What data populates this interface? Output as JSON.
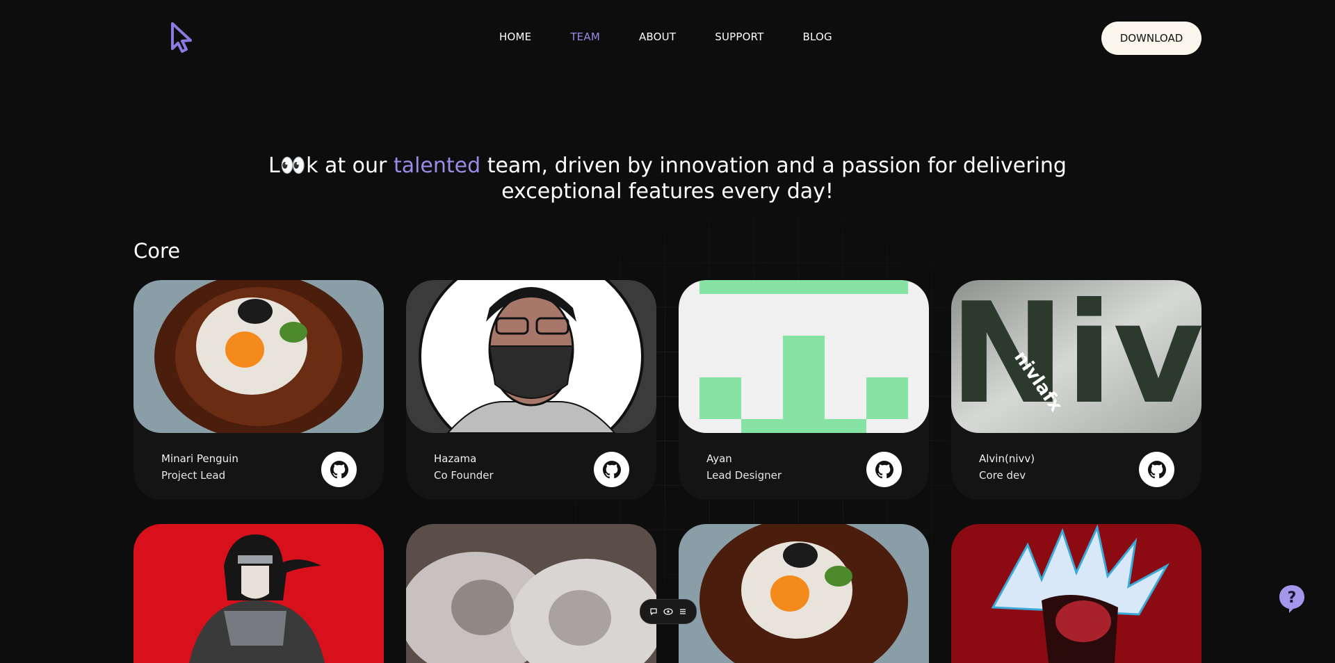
{
  "nav": {
    "items": [
      {
        "label": "HOME"
      },
      {
        "label": "TEAM",
        "active": true
      },
      {
        "label": "ABOUT"
      },
      {
        "label": "SUPPORT"
      },
      {
        "label": "BLOG"
      }
    ],
    "download_label": "DOWNLOAD"
  },
  "hero": {
    "part1": "L",
    "eyes": "👀",
    "part2": "k at our ",
    "accent": "talented",
    "part3": " team, driven by innovation and a passion for delivering",
    "line2": "exceptional features every day!"
  },
  "section": {
    "title": "Core"
  },
  "members": [
    {
      "name": "Minari Penguin",
      "role": "Project Lead"
    },
    {
      "name": "Hazama",
      "role": "Co Founder"
    },
    {
      "name": "Ayan",
      "role": "Lead Designer"
    },
    {
      "name": "Alvin(nivv)",
      "role": "Core dev"
    }
  ],
  "avatar_text": {
    "niv": "Niv",
    "nivlafx": "nivlafx"
  },
  "colors": {
    "accent": "#9b8ae6",
    "background": "#0d0d0d",
    "download_bg": "#fcf7ec",
    "ayan_green": "#86e3a4"
  },
  "icons": [
    "cursor-logo-icon",
    "github-icon",
    "chat-icon",
    "eye-icon",
    "menu-icon",
    "help-icon"
  ]
}
